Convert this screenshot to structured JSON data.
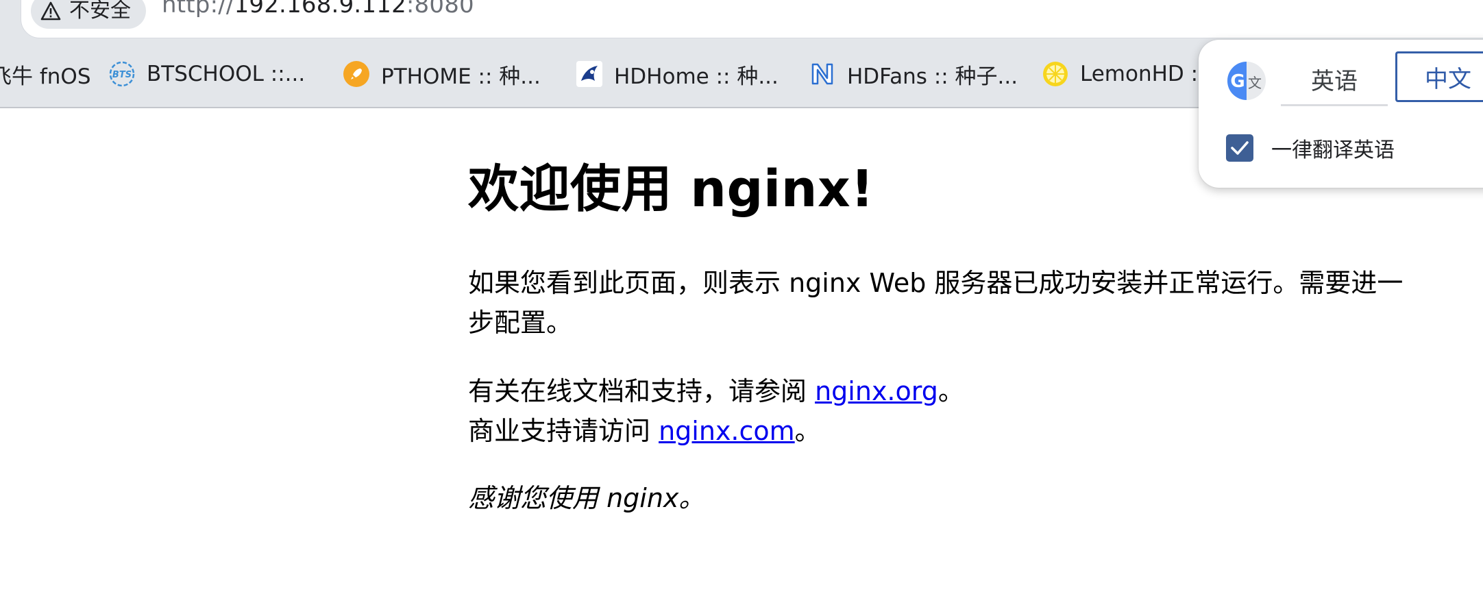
{
  "browser": {
    "security_label": "不安全",
    "url": {
      "scheme": "http://",
      "host": "192.168.9.112",
      "port": ":8080"
    },
    "bookmarks": [
      {
        "label": "飞牛 fnOS",
        "icon": "fnos-icon"
      },
      {
        "label": "BTSCHOOL ::...",
        "icon": "btschool-icon"
      },
      {
        "label": "PTHOME :: 种...",
        "icon": "pthome-rocket-icon"
      },
      {
        "label": "HDHome :: 种...",
        "icon": "hdhome-icon"
      },
      {
        "label": "HDFans :: 种子...",
        "icon": "hdfans-icon"
      },
      {
        "label": "LemonHD ::",
        "icon": "lemon-icon"
      }
    ]
  },
  "page": {
    "heading": "欢迎使用 nginx!",
    "para1": "如果您看到此页面，则表示 nginx Web 服务器已成功安装并正常运行。需要进一步配置。",
    "para2_prefix": "有关在线文档和支持，请参阅 ",
    "para2_link": "nginx.org",
    "para2_suffix": "。",
    "para3_prefix": "商业支持请访问 ",
    "para3_link": "nginx.com",
    "para3_suffix": "。",
    "thanks": "感谢您使用 nginx。"
  },
  "translate_popup": {
    "icon": "google-translate-icon",
    "source_language": "英语",
    "target_language": "中文",
    "always_translate_label": "一律翻译英语",
    "always_translate_checked": true,
    "accent_color": "#345ea8"
  }
}
